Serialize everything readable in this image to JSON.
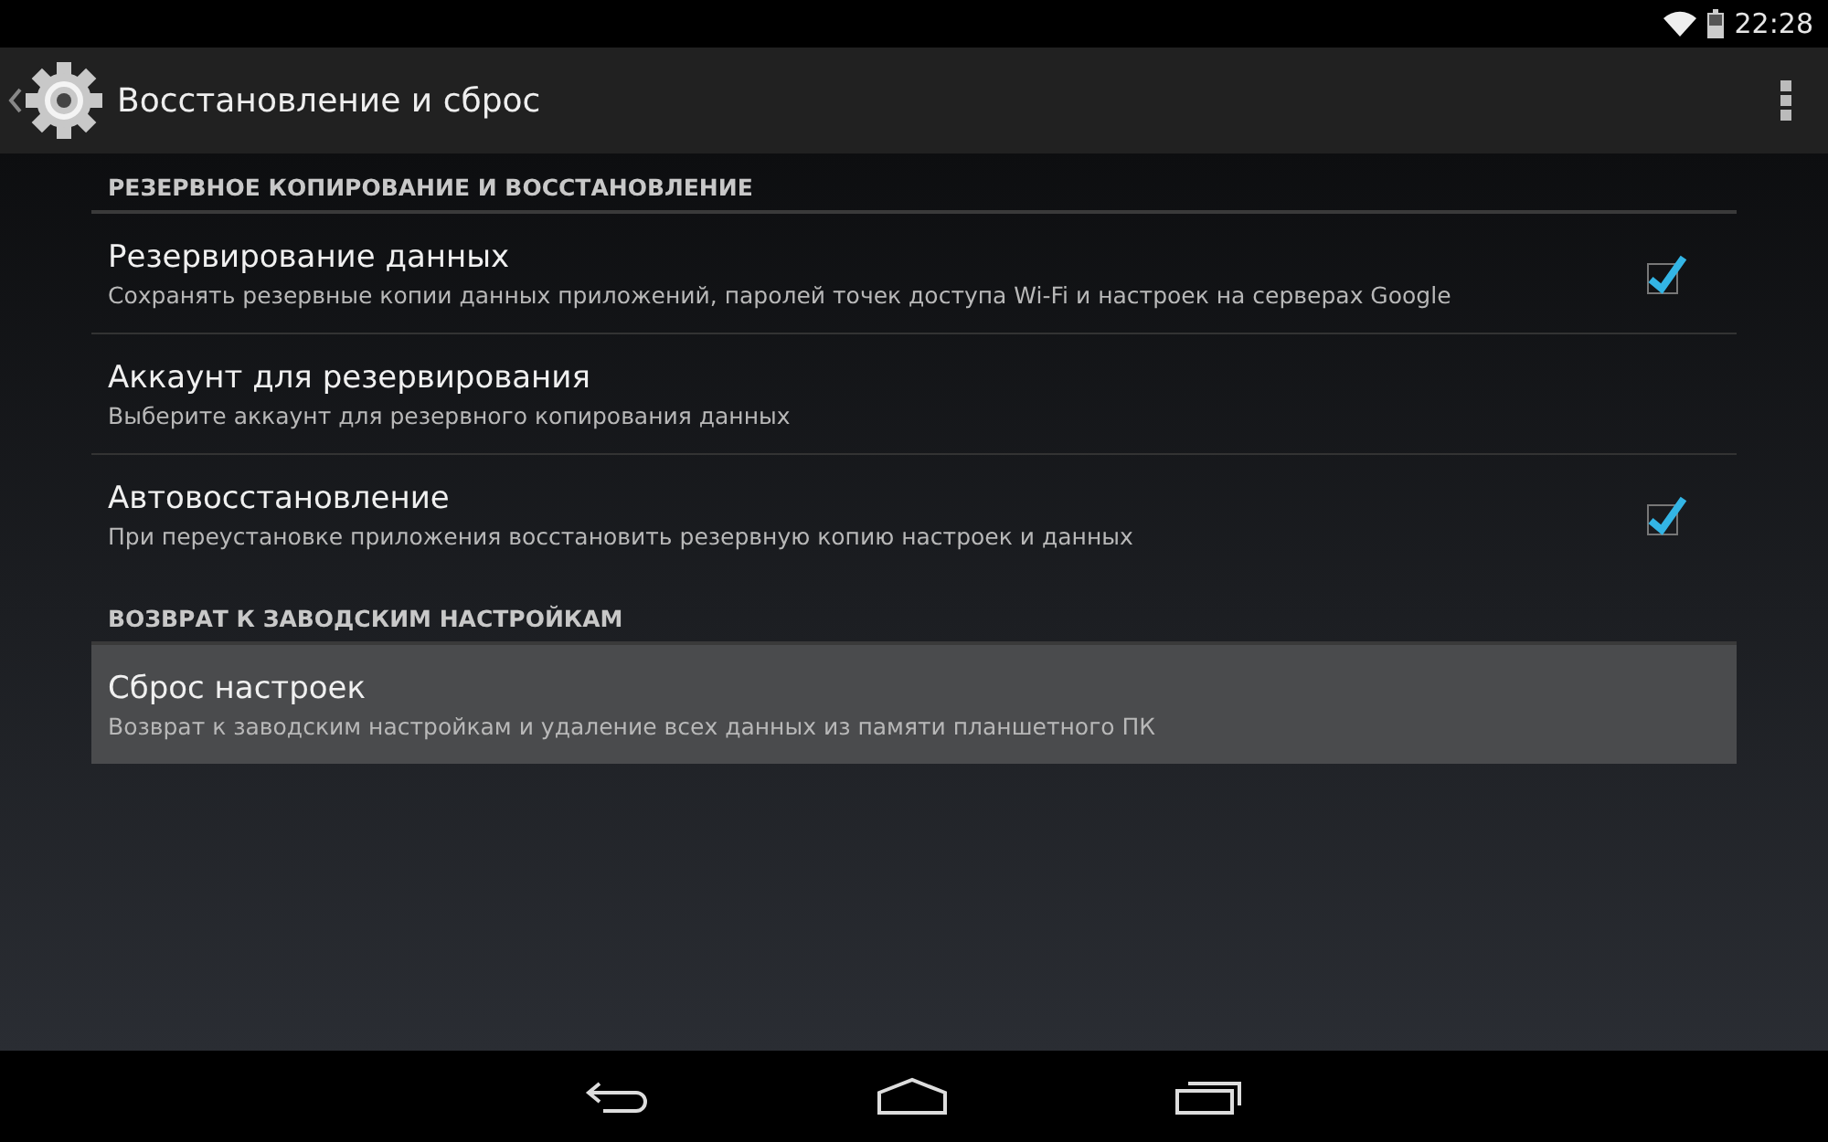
{
  "status_bar": {
    "time": "22:28"
  },
  "action_bar": {
    "title": "Восстановление и сброс"
  },
  "sections": [
    {
      "header": "РЕЗЕРВНОЕ КОПИРОВАНИЕ И ВОССТАНОВЛЕНИЕ",
      "items": [
        {
          "kind": "checkbox",
          "title": "Резервирование данных",
          "summary": "Сохранять резервные копии данных приложений, паролей точек доступа Wi-Fi и настроек на серверах Google",
          "checked": true,
          "selected": false
        },
        {
          "kind": "plain",
          "title": "Аккаунт для резервирования",
          "summary": "Выберите аккаунт для резервного копирования данных",
          "selected": false
        },
        {
          "kind": "checkbox",
          "title": "Автовосстановление",
          "summary": "При переустановке приложения восстановить резервную копию настроек и данных",
          "checked": true,
          "selected": false
        }
      ]
    },
    {
      "header": "ВОЗВРАТ К ЗАВОДСКИМ НАСТРОЙКАМ",
      "items": [
        {
          "kind": "plain",
          "title": "Сброс настроек",
          "summary": "Возврат к заводским настройкам и удаление всех данных из памяти планшетного ПК",
          "selected": true
        }
      ]
    }
  ]
}
